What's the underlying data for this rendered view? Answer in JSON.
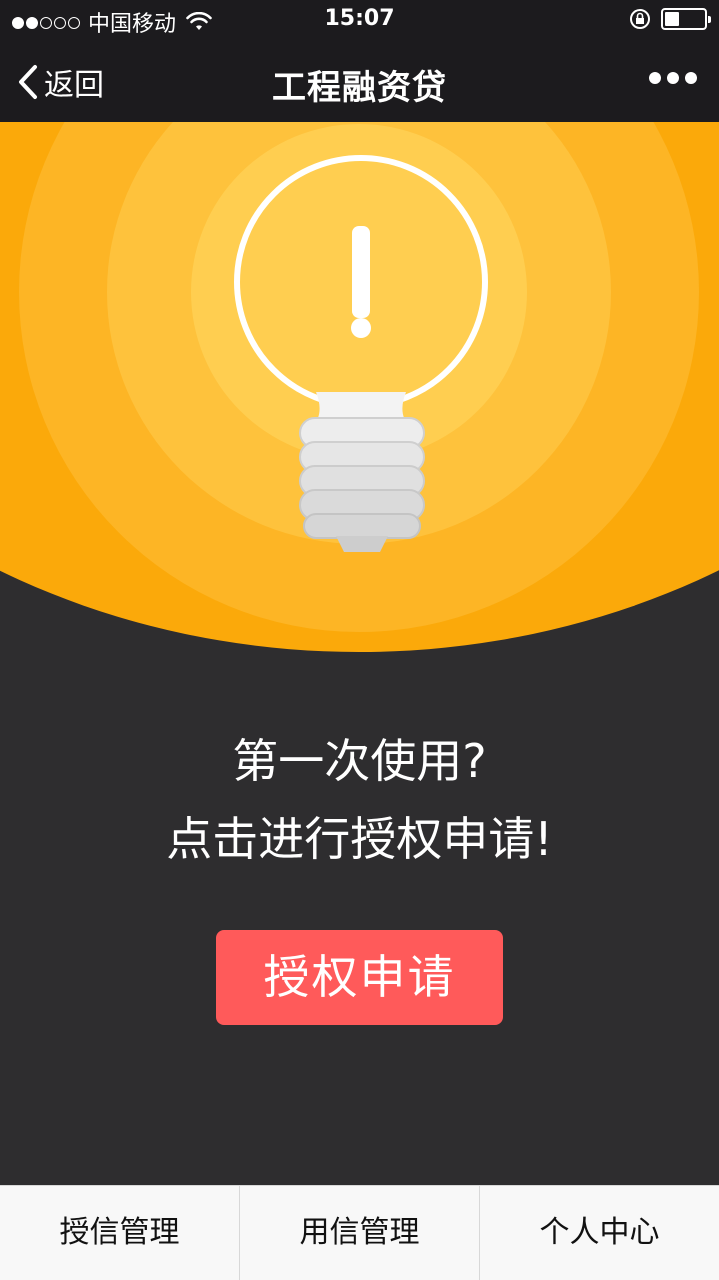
{
  "status_bar": {
    "carrier": "中国移动",
    "time": "15:07",
    "signal_filled": 2,
    "signal_total": 5
  },
  "nav": {
    "back_label": "返回",
    "title": "工程融资贷"
  },
  "hero": {
    "icon": "lightbulb-warning-icon",
    "colors": [
      "#fba90a",
      "#fdb525",
      "#fec23c",
      "#ffce50",
      "#ffd86a"
    ]
  },
  "message": {
    "line1": "第一次使用?",
    "line2": "点击进行授权申请!"
  },
  "apply_button": {
    "label": "授权申请",
    "color": "#ff5a5a"
  },
  "tabs": [
    {
      "label": "授信管理"
    },
    {
      "label": "用信管理"
    },
    {
      "label": "个人中心"
    }
  ]
}
